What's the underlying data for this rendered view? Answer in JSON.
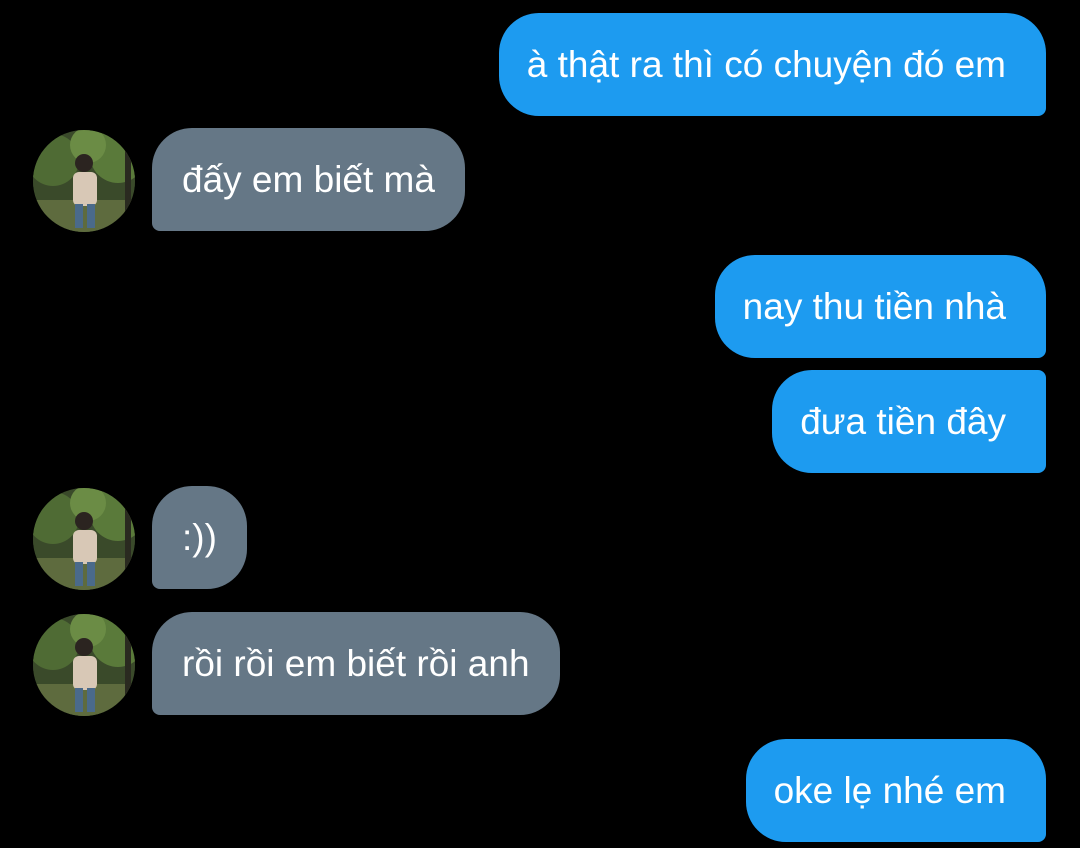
{
  "messages": [
    {
      "from": "me",
      "text": "à thật ra thì có chuyện đó em"
    },
    {
      "from": "them",
      "text": "đấy em biết mà"
    },
    {
      "from": "me",
      "text": "nay thu tiền nhà"
    },
    {
      "from": "me",
      "text": "đưa tiền đây"
    },
    {
      "from": "them",
      "text": ":))"
    },
    {
      "from": "them",
      "text": "rồi rồi em biết rồi anh"
    },
    {
      "from": "me",
      "text": "oke lẹ nhé em"
    }
  ],
  "colors": {
    "background": "#000000",
    "sent_bubble": "#1d9bf0",
    "received_bubble": "#657786",
    "text": "#ffffff"
  },
  "avatar_icon": "contact-photo-avatar"
}
